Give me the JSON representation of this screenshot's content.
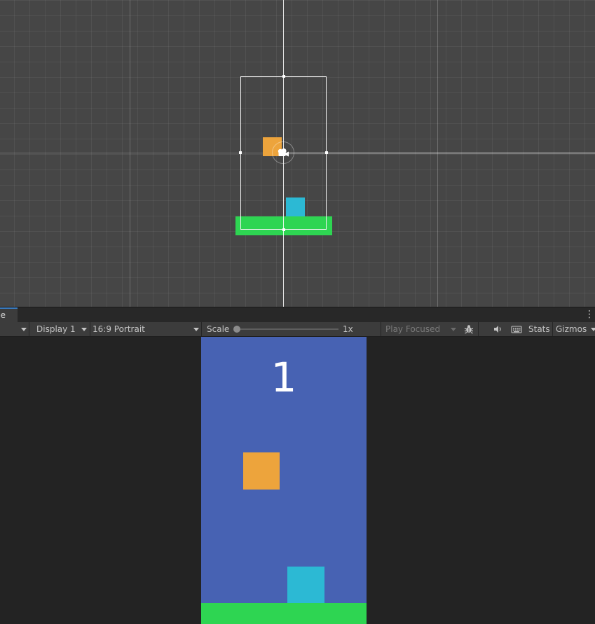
{
  "colors": {
    "scene_bg": "#464646",
    "game_bg": "#4762b3",
    "player": "#eda43c",
    "obstacle": "#2cb9d4",
    "ground": "#2ed552",
    "camera_frame": "#f2f2f2",
    "score_text": "#ffffff",
    "panel_dark": "#232323",
    "toolbar": "#3c3c3c",
    "tab_active_accent": "#3a79bb"
  },
  "scene_view": {
    "objects": [
      {
        "name": "player",
        "color": "#eda43c"
      },
      {
        "name": "obstacle",
        "color": "#2cb9d4"
      },
      {
        "name": "ground",
        "color": "#2ed552"
      }
    ],
    "camera_icon": "camera-icon"
  },
  "game_tab": {
    "label": "Game",
    "menu_icon": "vertical-dots-icon"
  },
  "toolbar": {
    "display": "Display 1",
    "aspect": "16:9 Portrait",
    "scale_label": "Scale",
    "scale_value": "1x",
    "play_mode": "Play Focused",
    "bug_icon": "bug-icon",
    "audio_icon": "speaker-icon",
    "keyboard_icon": "keyboard-icon",
    "stats": "Stats",
    "gizmos": "Gizmos"
  },
  "game_view": {
    "score": "1"
  }
}
